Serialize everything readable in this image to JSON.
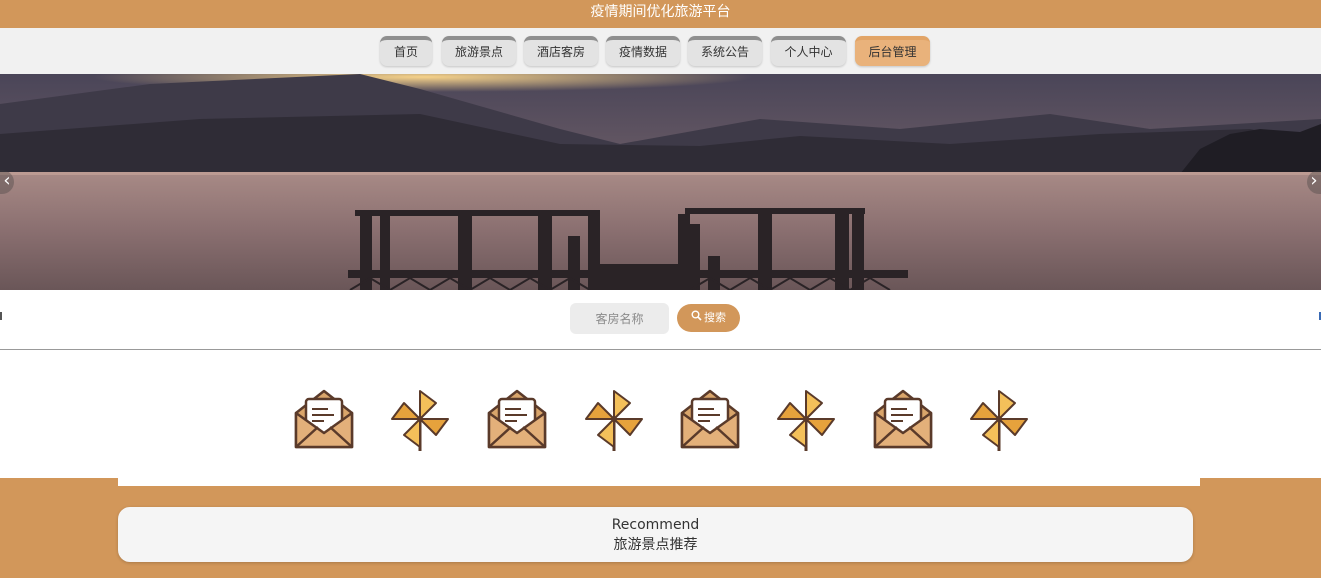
{
  "header": {
    "title": "疫情期间优化旅游平台"
  },
  "nav": [
    {
      "label": "首页"
    },
    {
      "label": "旅游景点"
    },
    {
      "label": "酒店客房"
    },
    {
      "label": "疫情数据"
    },
    {
      "label": "系统公告"
    },
    {
      "label": "个人中心"
    },
    {
      "label": "后台管理"
    }
  ],
  "banner": {
    "prev": "‹",
    "next": "›"
  },
  "search": {
    "placeholder": "客房名称",
    "button_label": "搜索"
  },
  "icons": [
    "envelope-icon",
    "pinwheel-icon",
    "envelope-icon",
    "pinwheel-icon",
    "envelope-icon",
    "pinwheel-icon",
    "envelope-icon",
    "pinwheel-icon"
  ],
  "recommend": {
    "en": "Recommend",
    "cn": "旅游景点推荐"
  },
  "colors": {
    "brand": "#d2975a",
    "active_tab": "#e9b27b"
  }
}
